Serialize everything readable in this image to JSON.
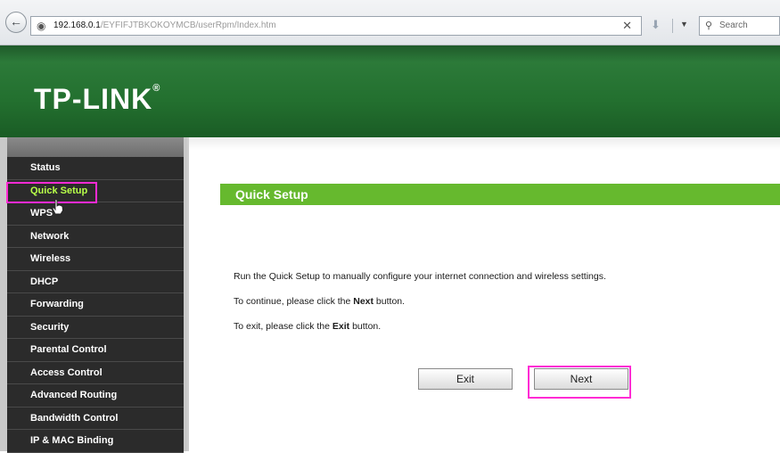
{
  "browser": {
    "url_host": "192.168.0.1",
    "url_path": "/EYFIFJTBKOKOYMCB/userRpm/Index.htm",
    "search_placeholder": "Search"
  },
  "header": {
    "logo": "TP-LINK",
    "logo_mark": "®"
  },
  "sidebar": {
    "items": [
      {
        "label": "Status"
      },
      {
        "label": "Quick Setup"
      },
      {
        "label": "WPS"
      },
      {
        "label": "Network"
      },
      {
        "label": "Wireless"
      },
      {
        "label": "DHCP"
      },
      {
        "label": "Forwarding"
      },
      {
        "label": "Security"
      },
      {
        "label": "Parental Control"
      },
      {
        "label": "Access Control"
      },
      {
        "label": "Advanced Routing"
      },
      {
        "label": "Bandwidth Control"
      },
      {
        "label": "IP & MAC Binding"
      }
    ]
  },
  "main": {
    "title": "Quick Setup",
    "para1": "Run the Quick Setup to manually configure your internet connection and wireless settings.",
    "para2_pre": "To continue, please click the ",
    "para2_bold": "Next",
    "para2_post": " button.",
    "para3_pre": "To exit, please click the ",
    "para3_bold": "Exit",
    "para3_post": "  button.",
    "exit_label": "Exit",
    "next_label": "Next"
  },
  "colors": {
    "highlight": "#ff2bd4",
    "accent_green": "#66b92e",
    "active_item": "#b8ff4a"
  }
}
